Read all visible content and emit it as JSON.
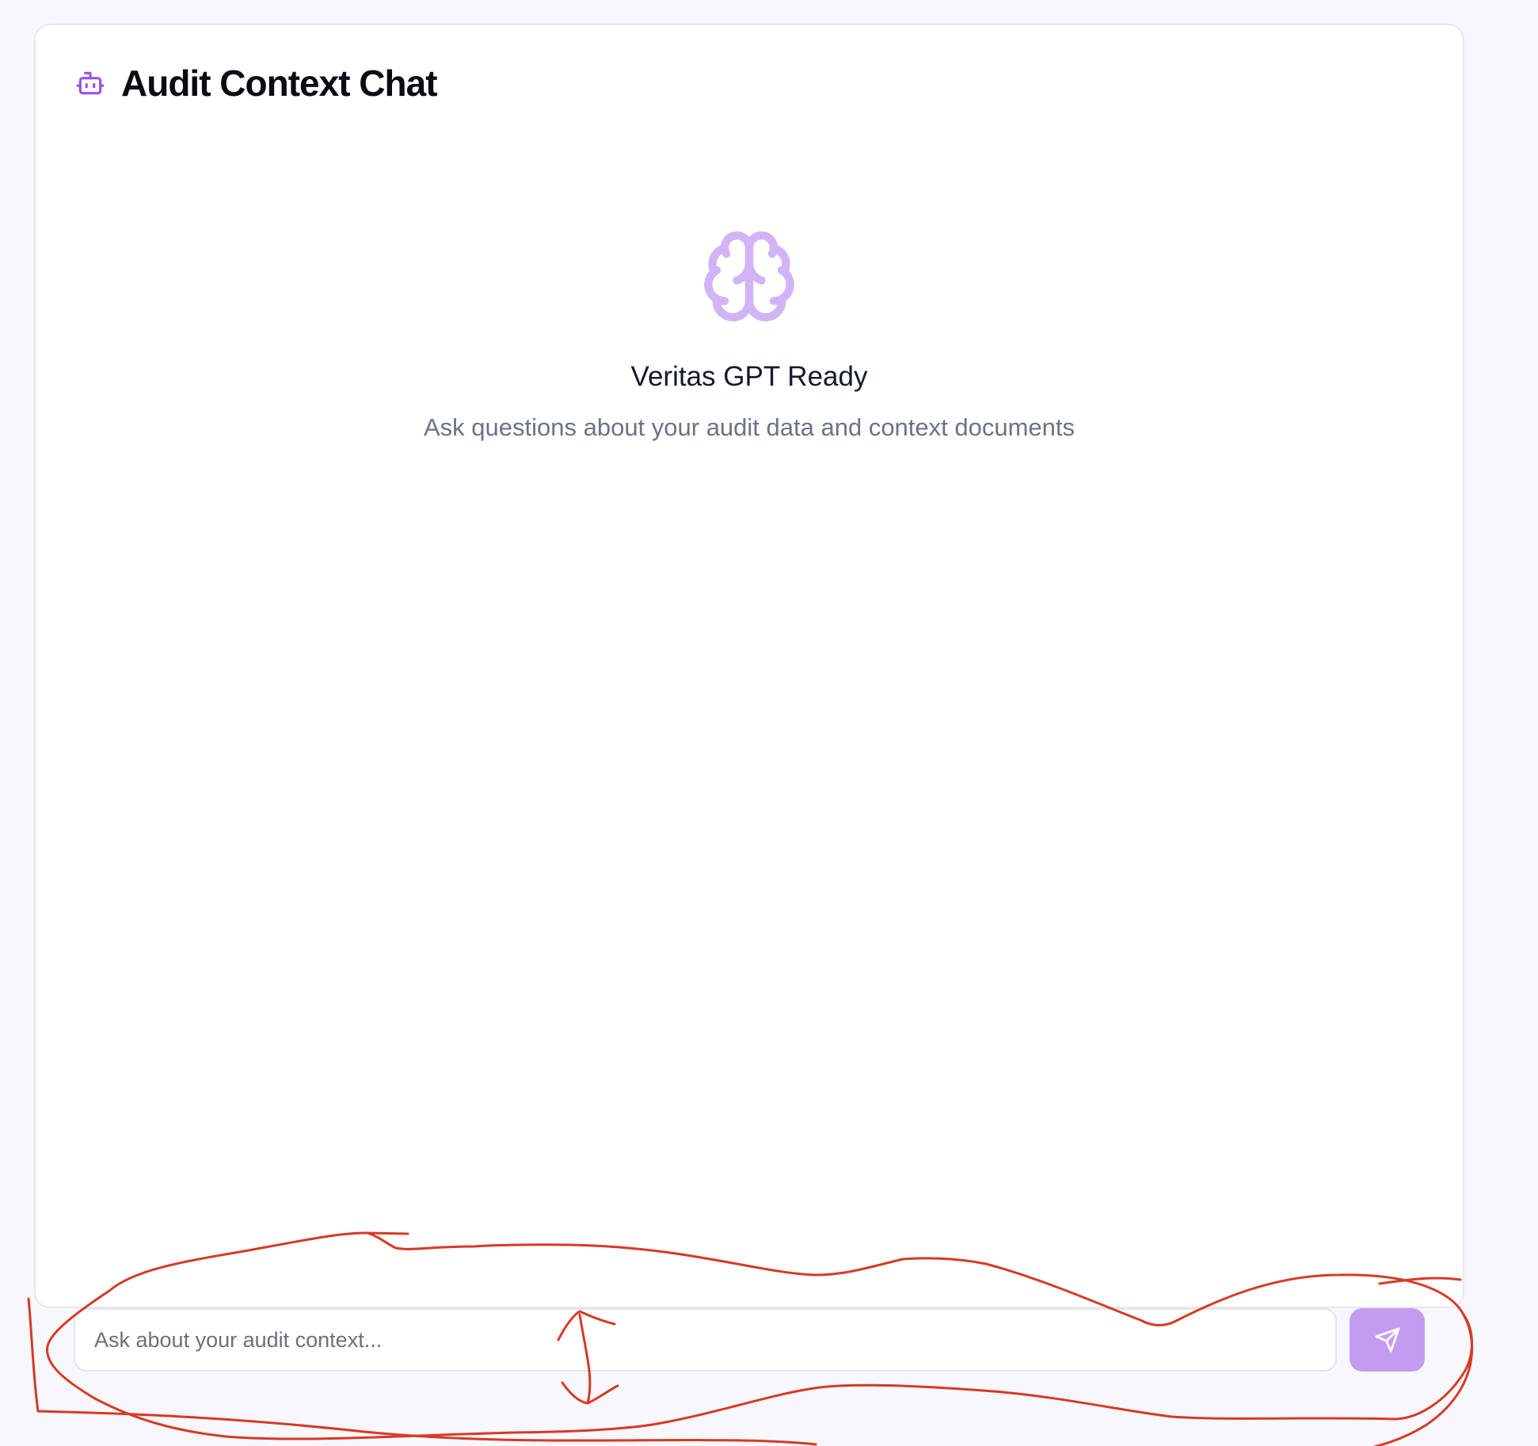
{
  "header": {
    "title": "Audit Context Chat",
    "icon": "bot-icon"
  },
  "empty_state": {
    "icon": "brain-icon",
    "title": "Veritas GPT Ready",
    "subtitle": "Ask questions about your audit data and context documents"
  },
  "composer": {
    "placeholder": "Ask about your audit context...",
    "value": "",
    "send_icon": "send-icon"
  },
  "colors": {
    "accent": "#9b51e0",
    "brain": "#d2b4f6",
    "send_button": "#c39cf1",
    "annotation": "#d63a25",
    "background": "#f8f7fc"
  }
}
